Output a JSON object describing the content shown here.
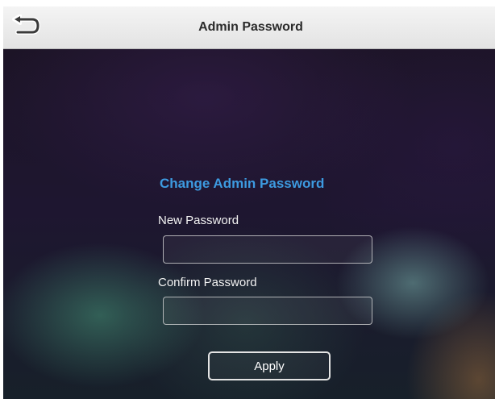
{
  "header": {
    "title": "Admin Password",
    "back_icon": "back-arrow-icon"
  },
  "form": {
    "heading": "Change Admin Password",
    "new_password": {
      "label": "New Password",
      "value": "",
      "placeholder": ""
    },
    "confirm_password": {
      "label": "Confirm Password",
      "value": "",
      "placeholder": ""
    },
    "apply_label": "Apply"
  },
  "colors": {
    "heading": "#3d9ae0",
    "header_bg": "#ececec",
    "label_text": "#f2f2f2",
    "background": "#1c1426"
  }
}
